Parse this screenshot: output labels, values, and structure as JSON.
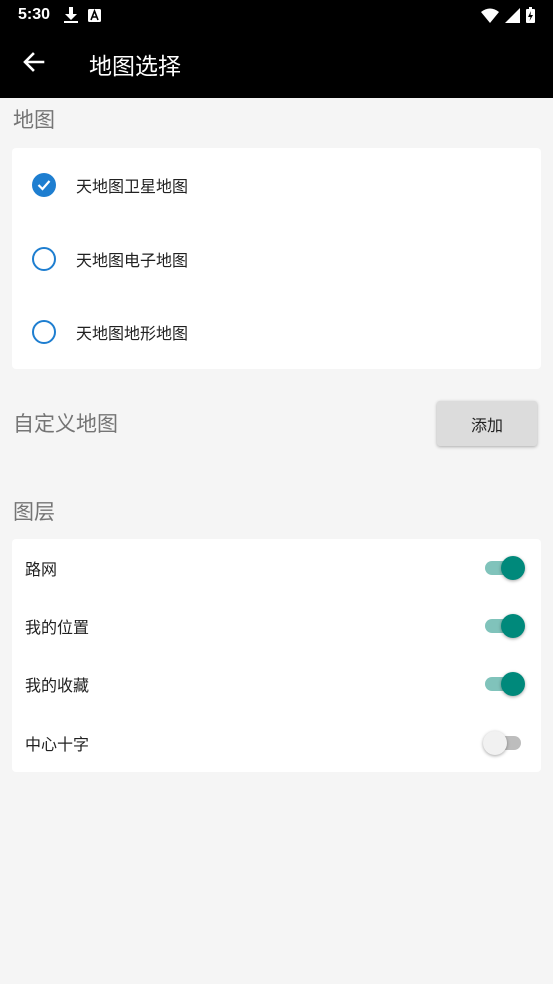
{
  "status_bar": {
    "time": "5:30",
    "icons": [
      "download-icon",
      "a-notification-icon",
      "wifi-icon",
      "signal-icon",
      "battery-icon"
    ]
  },
  "app_bar": {
    "title": "地图选择",
    "back_icon": "arrow-left-icon"
  },
  "maps_section": {
    "label": "地图",
    "options": [
      {
        "label": "天地图卫星地图",
        "selected": true
      },
      {
        "label": "天地图电子地图",
        "selected": false
      },
      {
        "label": "天地图地形地图",
        "selected": false
      }
    ]
  },
  "custom_map": {
    "label": "自定义地图",
    "add_label": "添加"
  },
  "layers_section": {
    "label": "图层",
    "items": [
      {
        "label": "路网",
        "on": true
      },
      {
        "label": "我的位置",
        "on": true
      },
      {
        "label": "我的收藏",
        "on": true
      },
      {
        "label": "中心十字",
        "on": false
      }
    ]
  },
  "colors": {
    "accent_blue": "#1e7ed0",
    "switch_on": "#00897b",
    "switch_track_on": "#80c3bb",
    "bar_bg": "#000000",
    "page_bg": "#f5f5f5"
  }
}
